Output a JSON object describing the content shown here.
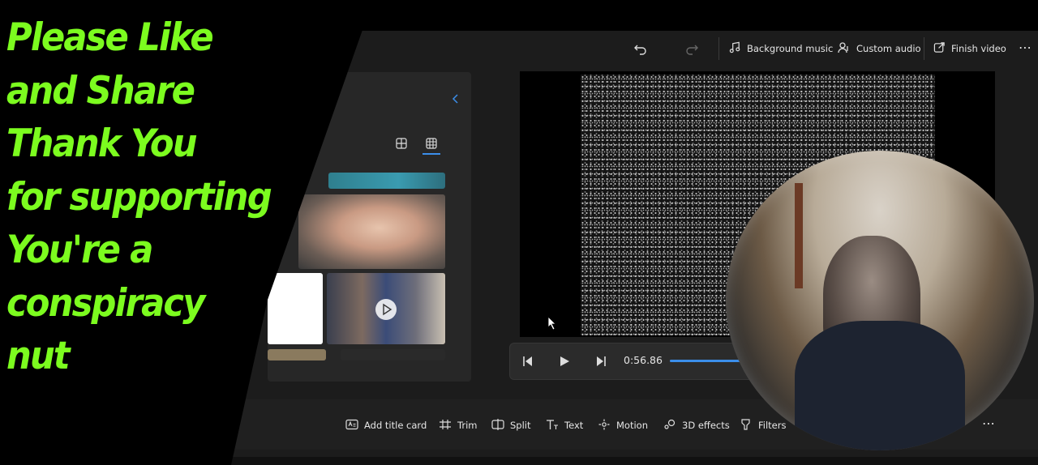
{
  "toolbar_top": {
    "background_music": "Background music",
    "custom_audio": "Custom audio",
    "finish_video": "Finish video",
    "more": "⋯"
  },
  "player": {
    "time": "0:56.86",
    "progress": 0.88
  },
  "edit_tools": {
    "add_title_card": "Add title card",
    "trim": "Trim",
    "split": "Split",
    "text": "Text",
    "motion": "Motion",
    "effects3d": "3D effects",
    "filters": "Filters",
    "more": "⋯"
  },
  "promo": {
    "line1": "Please Like",
    "line2": "and Share",
    "line3": "Thank You",
    "line4": "for supporting",
    "line5": "You're a",
    "line6": "conspiracy",
    "line7": "nut"
  },
  "colors": {
    "accent": "#3b8eea",
    "promo_text": "#7cfc1f"
  },
  "icons": {
    "undo": "undo-icon",
    "redo": "redo-icon",
    "music": "music-note-icon",
    "custom_audio": "custom-audio-icon",
    "export": "export-icon",
    "collapse": "chevron-left-icon"
  }
}
